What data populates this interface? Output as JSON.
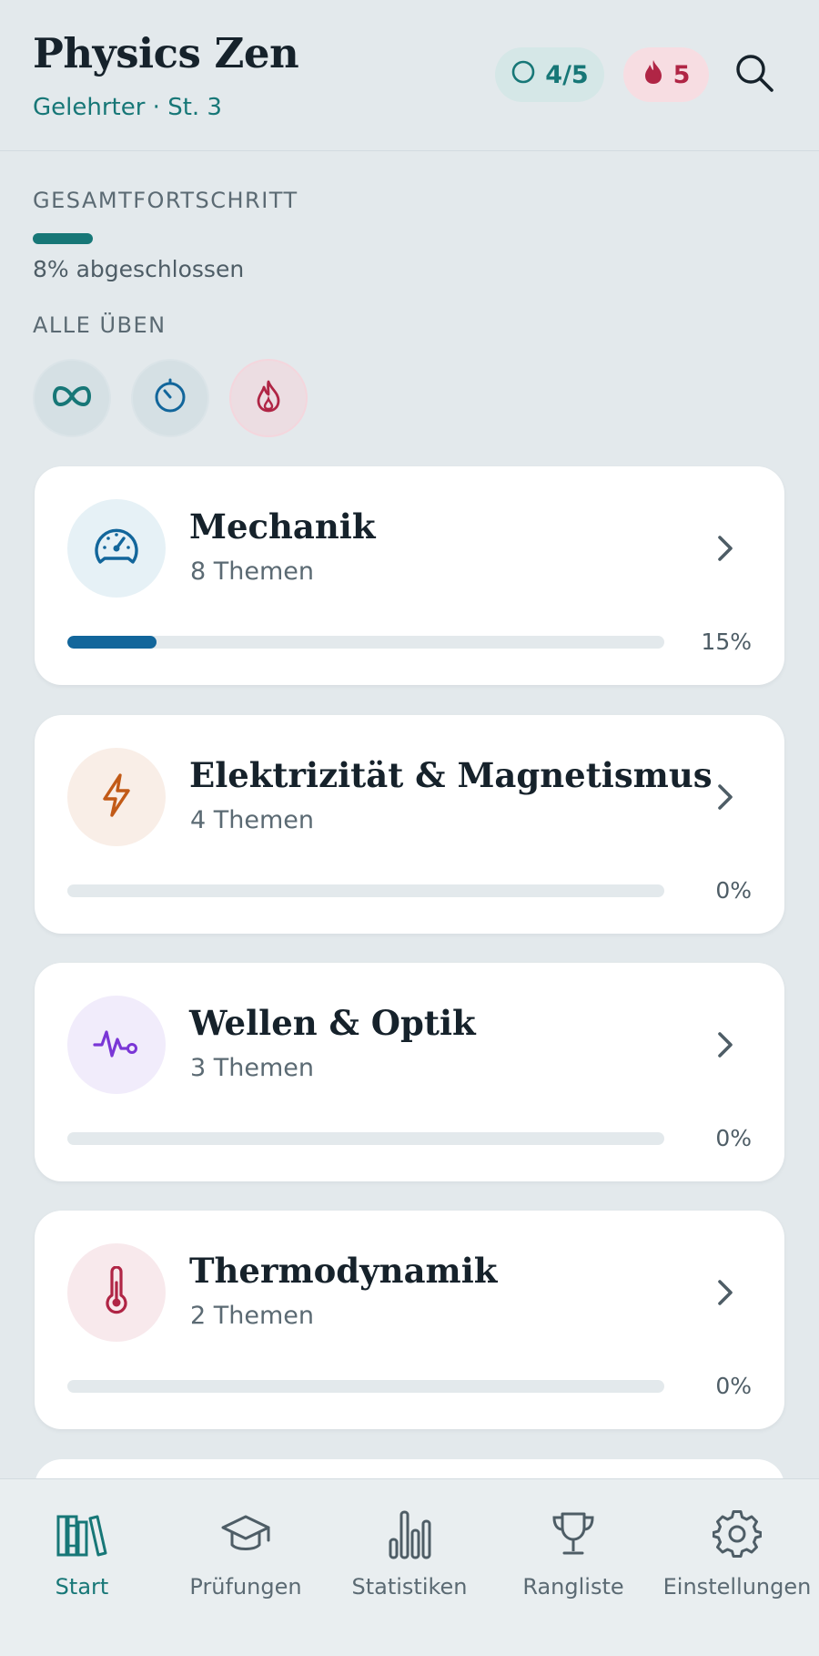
{
  "header": {
    "title": "Physics Zen",
    "subtitle": "Gelehrter · St. 3",
    "daily_goal": "4/5",
    "streak": "5"
  },
  "overview": {
    "label": "GESAMTFORTSCHRITT",
    "progress_percent": 8,
    "progress_text": "8% abgeschlossen",
    "practice_label": "ALLE ÜBEN",
    "practice_modes": [
      "infinity-icon",
      "timer-icon",
      "flame-icon"
    ]
  },
  "subjects": [
    {
      "title": "Mechanik",
      "topics": "8 Themen",
      "percent": 15,
      "percent_text": "15%",
      "icon": "speedometer-icon",
      "color": "#12669b",
      "icon_bg": "#e6f1f6"
    },
    {
      "title": "Elektrizität & Magnetismus",
      "topics": "4 Themen",
      "percent": 0,
      "percent_text": "0%",
      "icon": "lightning-icon",
      "color": "#c25a17",
      "icon_bg": "#f9eee7"
    },
    {
      "title": "Wellen & Optik",
      "topics": "3 Themen",
      "percent": 0,
      "percent_text": "0%",
      "icon": "wave-icon",
      "color": "#7a36d6",
      "icon_bg": "#f1ecfb"
    },
    {
      "title": "Thermodynamik",
      "topics": "2 Themen",
      "percent": 0,
      "percent_text": "0%",
      "icon": "thermometer-icon",
      "color": "#b02545",
      "icon_bg": "#f8e9ec"
    }
  ],
  "nav": [
    {
      "label": "Start",
      "icon": "books-icon",
      "active": true
    },
    {
      "label": "Prüfungen",
      "icon": "graduation-cap-icon",
      "active": false
    },
    {
      "label": "Statistiken",
      "icon": "bar-chart-icon",
      "active": false
    },
    {
      "label": "Rangliste",
      "icon": "trophy-icon",
      "active": false
    },
    {
      "label": "Einstellungen",
      "icon": "gear-icon",
      "active": false
    }
  ],
  "colors": {
    "accent": "#177777",
    "streak": "#b02545",
    "background": "#e3e9ec"
  }
}
